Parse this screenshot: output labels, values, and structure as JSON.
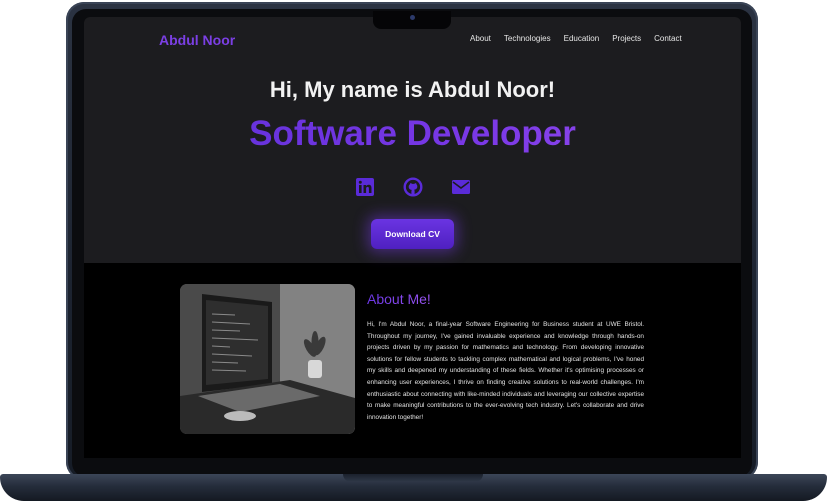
{
  "header": {
    "brand": "Abdul Noor",
    "nav": [
      "About",
      "Technologies",
      "Education",
      "Projects",
      "Contact"
    ]
  },
  "hero": {
    "greeting": "Hi, My name is Abdul Noor!",
    "role": "Software Developer",
    "social_icons": [
      "linkedin-icon",
      "github-icon",
      "mail-icon"
    ],
    "cv_button": "Download CV"
  },
  "about": {
    "title": "About Me!",
    "text": "Hi, I'm Abdul Noor, a final-year Software Engineering for Business student at UWE Bristol. Throughout my journey, I've gained invaluable experience and knowledge through hands-on projects driven by my passion for mathematics and technology. From developing innovative solutions for fellow students to tackling complex mathematical and logical problems, I've honed my skills and deepened my understanding of these fields. Whether it's optimising processes or enhancing user experiences, I thrive on finding creative solutions to real-world challenges. I'm enthusiastic about connecting with like-minded individuals and leveraging our collective expertise to make meaningful contributions to the ever-evolving tech industry. Let's collaborate and drive innovation together!"
  },
  "colors": {
    "accent": "#6a34e2",
    "hero_bg": "#1c1c1f",
    "about_bg": "#000000"
  }
}
